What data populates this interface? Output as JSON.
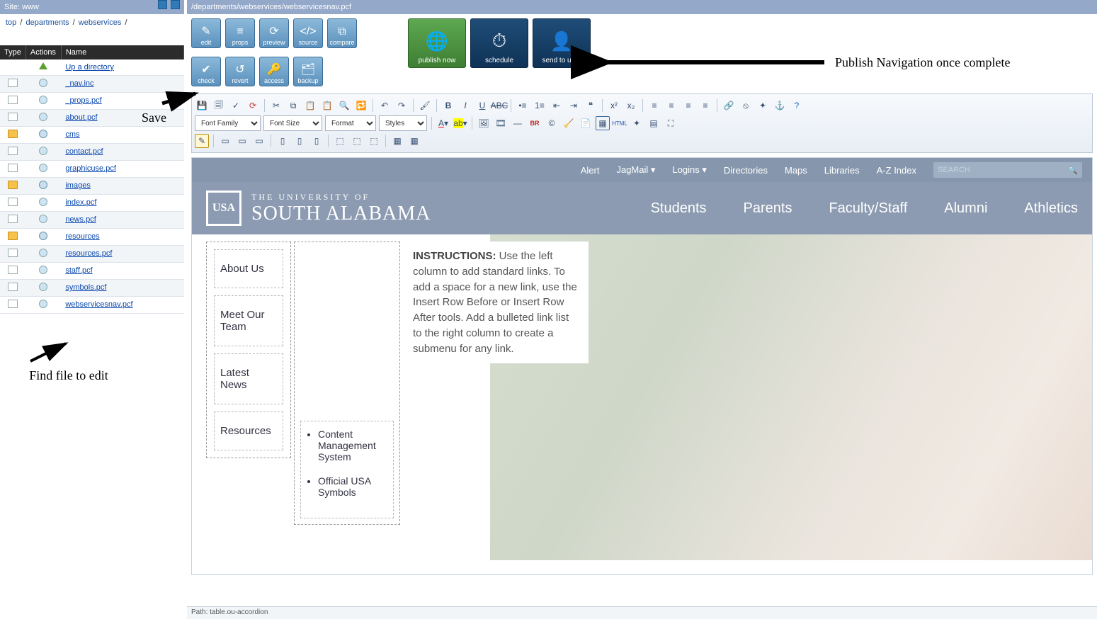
{
  "site_bar": {
    "label": "Site: www"
  },
  "breadcrumb": {
    "items": [
      "top",
      "departments",
      "webservices"
    ]
  },
  "file_table": {
    "headers": {
      "type": "Type",
      "actions": "Actions",
      "name": "Name"
    },
    "up": "Up a directory",
    "rows": [
      {
        "type": "page",
        "action": "bulb",
        "name": "_nav.inc"
      },
      {
        "type": "page",
        "action": "bulb",
        "name": "_props.pcf"
      },
      {
        "type": "page",
        "action": "bulb",
        "name": "about.pcf"
      },
      {
        "type": "folder",
        "action": "rss",
        "name": "cms"
      },
      {
        "type": "page",
        "action": "bulb",
        "name": "contact.pcf"
      },
      {
        "type": "page",
        "action": "bulb",
        "name": "graphicuse.pcf"
      },
      {
        "type": "folder",
        "action": "rss",
        "name": "images"
      },
      {
        "type": "page",
        "action": "bulb",
        "name": "index.pcf"
      },
      {
        "type": "page",
        "action": "bulb",
        "name": "news.pcf"
      },
      {
        "type": "folder",
        "action": "rss",
        "name": "resources"
      },
      {
        "type": "page",
        "action": "bulb",
        "name": "resources.pcf"
      },
      {
        "type": "page",
        "action": "bulb",
        "name": "staff.pcf"
      },
      {
        "type": "page",
        "action": "bulb",
        "name": "symbols.pcf"
      },
      {
        "type": "page",
        "action": "bulb",
        "name": "webservicesnav.pcf"
      }
    ]
  },
  "path": "/departments/webservices/webservicesnav.pcf",
  "toolbar_buttons_row1": [
    {
      "label": "edit",
      "glyph": "✎"
    },
    {
      "label": "props",
      "glyph": "≡"
    },
    {
      "label": "preview",
      "glyph": "⟳"
    },
    {
      "label": "source",
      "glyph": "</>"
    },
    {
      "label": "compare",
      "glyph": "⧉"
    }
  ],
  "toolbar_buttons_row2": [
    {
      "label": "check",
      "glyph": "✔"
    },
    {
      "label": "revert",
      "glyph": "↺"
    },
    {
      "label": "access",
      "glyph": "🔑"
    },
    {
      "label": "backup",
      "glyph": "🗂"
    }
  ],
  "publish_buttons": [
    {
      "label": "publish now",
      "glyph": "🌐",
      "cls": "green"
    },
    {
      "label": "schedule",
      "glyph": "⏱",
      "cls": "blue"
    },
    {
      "label": "send to user",
      "glyph": "👤",
      "cls": "blue"
    }
  ],
  "editor_selects": {
    "font_family": "Font Family",
    "font_size": "Font Size",
    "format": "Format",
    "styles": "Styles"
  },
  "annotations": {
    "save": "Save",
    "publish": "Publish Navigation once complete",
    "find_file": "Find file to edit"
  },
  "usa": {
    "topnav": [
      "Alert",
      "JagMail",
      "Logins",
      "Directories",
      "Maps",
      "Libraries",
      "A-Z Index"
    ],
    "search_placeholder": "SEARCH",
    "logo_line1": "THE UNIVERSITY OF",
    "logo_line2": "SOUTH ALABAMA",
    "logo_mark": "USA",
    "mainnav": [
      "Students",
      "Parents",
      "Faculty/Staff",
      "Alumni",
      "Athletics"
    ]
  },
  "nav_cells": [
    "About Us",
    "Meet Our Team",
    "Latest News",
    "Resources"
  ],
  "sub_items": [
    "Content Management System",
    "Official USA Symbols"
  ],
  "instructions_label": "INSTRUCTIONS:",
  "instructions_body": " Use the left column to add standard links. To add a space for a new link, use the Insert Row Before or Insert Row After tools. Add a bulleted link list to the right column to create a submenu for any link.",
  "status_path": "Path: table.ou-accordion"
}
